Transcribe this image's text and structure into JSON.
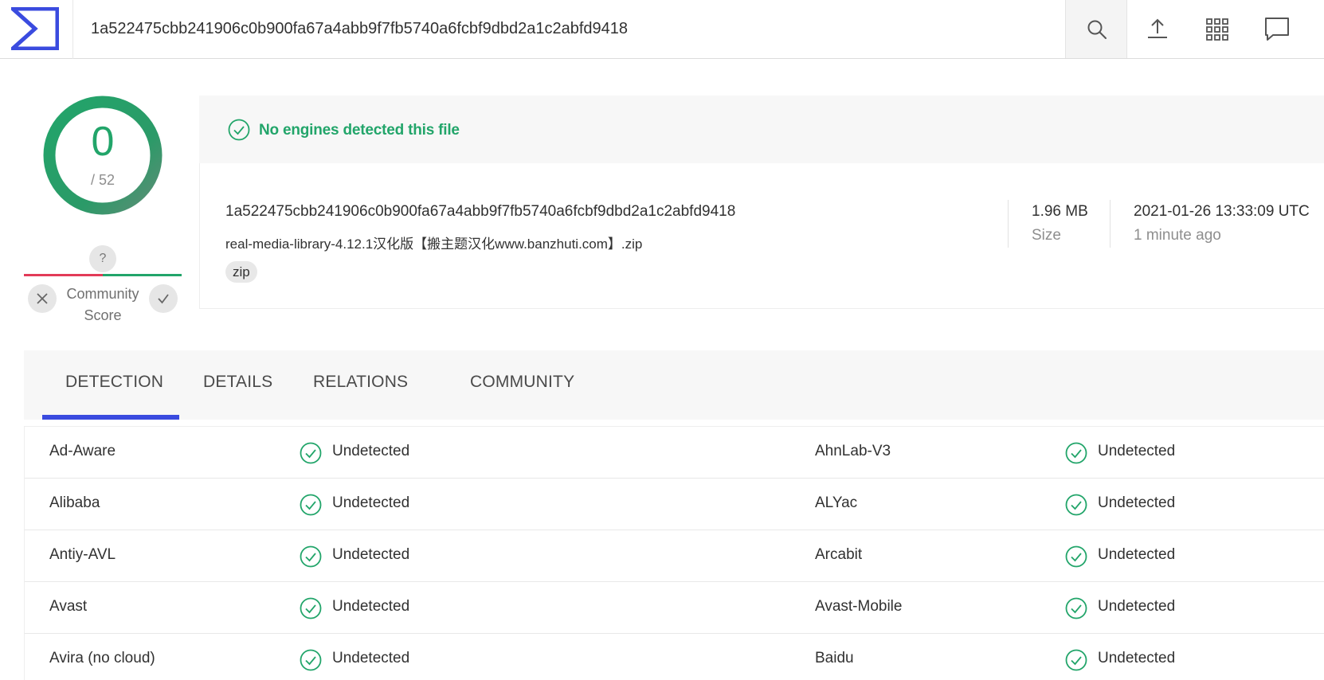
{
  "search": {
    "query": "1a522475cbb241906c0b900fa67a4abb9f7fb5740a6fcbf9dbd2a1c2abfd9418"
  },
  "score": {
    "detected": "0",
    "total": "/ 52",
    "community_question": "?",
    "community_label_line1": "Community",
    "community_label_line2": "Score"
  },
  "banner": {
    "message": "No engines detected this file"
  },
  "file": {
    "hash": "1a522475cbb241906c0b900fa67a4abb9f7fb5740a6fcbf9dbd2a1c2abfd9418",
    "name": "real-media-library-4.12.1汉化版【搬主题汉化www.banzhuti.com】.zip",
    "tag": "zip",
    "size_value": "1.96 MB",
    "size_label": "Size",
    "date_value": "2021-01-26 13:33:09 UTC",
    "date_relative": "1 minute ago"
  },
  "tabs": [
    {
      "label": "DETECTION",
      "active": true
    },
    {
      "label": "DETAILS",
      "active": false
    },
    {
      "label": "RELATIONS",
      "active": false
    },
    {
      "label": "COMMUNITY",
      "active": false
    }
  ],
  "detections": [
    {
      "left_engine": "Ad-Aware",
      "left_result": "Undetected",
      "right_engine": "AhnLab-V3",
      "right_result": "Undetected"
    },
    {
      "left_engine": "Alibaba",
      "left_result": "Undetected",
      "right_engine": "ALYac",
      "right_result": "Undetected"
    },
    {
      "left_engine": "Antiy-AVL",
      "left_result": "Undetected",
      "right_engine": "Arcabit",
      "right_result": "Undetected"
    },
    {
      "left_engine": "Avast",
      "left_result": "Undetected",
      "right_engine": "Avast-Mobile",
      "right_result": "Undetected"
    },
    {
      "left_engine": "Avira (no cloud)",
      "left_result": "Undetected",
      "right_engine": "Baidu",
      "right_result": "Undetected"
    }
  ],
  "colors": {
    "accent_blue": "#3a4bdf",
    "clean_green": "#22a56a",
    "malicious_red": "#e23b58"
  },
  "icons": {
    "logo": "virustotal-sigma-logo",
    "search": "search-icon",
    "upload": "upload-icon",
    "apps": "grid-icon",
    "chat": "chat-icon",
    "clean": "check-circle-icon"
  }
}
